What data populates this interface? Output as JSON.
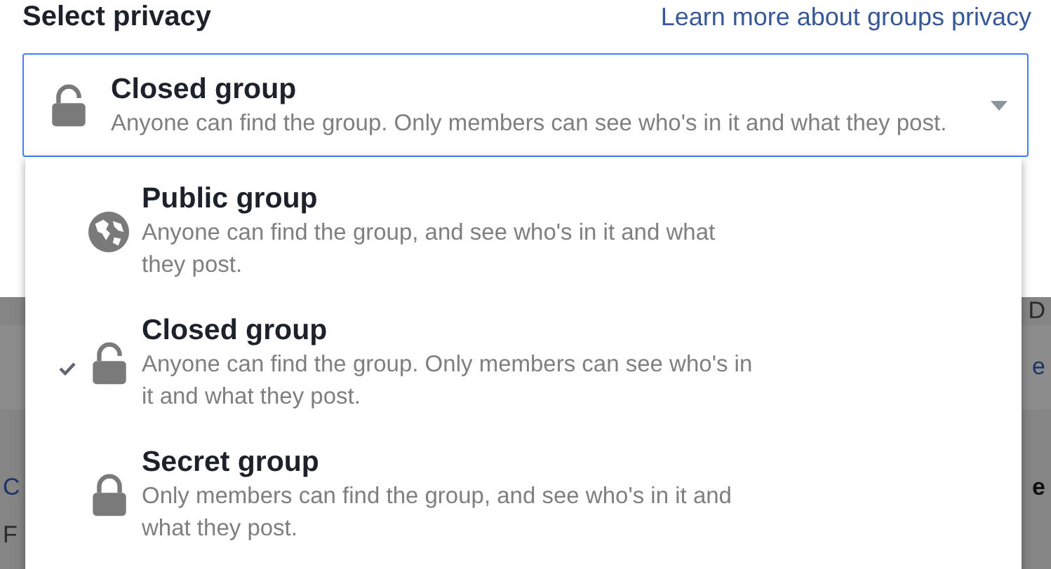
{
  "header": {
    "title": "Select privacy",
    "link": "Learn more about groups privacy"
  },
  "select": {
    "kind": "closed",
    "title": "Closed group",
    "description": "Anyone can find the group. Only members can see who's in it and what they post."
  },
  "options": [
    {
      "kind": "public",
      "title": "Public group",
      "description": "Anyone can find the group, and see who's in it and what they post.",
      "selected": false
    },
    {
      "kind": "closed",
      "title": "Closed group",
      "description": "Anyone can find the group. Only members can see who's in it and what they post.",
      "selected": true
    },
    {
      "kind": "secret",
      "title": "Secret group",
      "description": "Only members can find the group, and see who's in it and what they post.",
      "selected": false
    }
  ],
  "background": [
    {
      "right": "D"
    },
    {
      "right": "e",
      "right_link": true
    },
    {
      "left": "C",
      "left_link": true,
      "right": "e"
    },
    {
      "left": "F"
    }
  ]
}
